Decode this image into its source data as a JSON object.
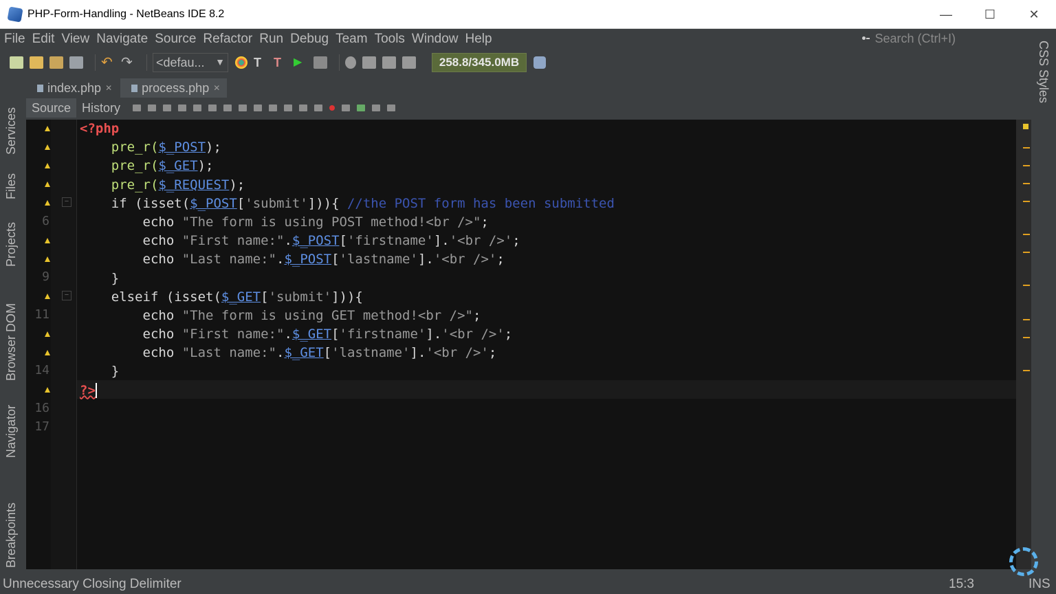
{
  "window": {
    "title": "PHP-Form-Handling - NetBeans IDE 8.2",
    "minimize": "—",
    "maximize": "☐",
    "close": "✕"
  },
  "menu": [
    "File",
    "Edit",
    "View",
    "Navigate",
    "Source",
    "Refactor",
    "Run",
    "Debug",
    "Team",
    "Tools",
    "Window",
    "Help"
  ],
  "search": {
    "placeholder": "Search (Ctrl+I)"
  },
  "toolbar": {
    "config": "<defau...",
    "memory": "258.8/345.0MB"
  },
  "left_tabs": [
    "Services",
    "Files",
    "Projects",
    "Browser DOM",
    "Navigator",
    "Breakpoints"
  ],
  "right_tabs": [
    "CSS Styles"
  ],
  "editor_tabs": [
    {
      "label": "index.php",
      "active": false
    },
    {
      "label": "process.php",
      "active": true
    }
  ],
  "editor_modes": {
    "source": "Source",
    "history": "History"
  },
  "line_numbers": {
    "l6": "6",
    "l9": "9",
    "l11": "11",
    "l14": "14",
    "l16": "16",
    "l17": "17"
  },
  "code": {
    "l1": "<?php",
    "l2_fn": "pre_r(",
    "l2_var": "$_POST",
    "l2_end": ");",
    "l3_fn": "pre_r(",
    "l3_var": "$_GET",
    "l3_end": ");",
    "l4_fn": "pre_r(",
    "l4_var": "$_REQUEST",
    "l4_end": ");",
    "l5_a": "if (isset(",
    "l5_var": "$_POST",
    "l5_b": "[",
    "l5_str": "'submit'",
    "l5_c": "])){ ",
    "l5_cmt": "//the POST form has been submitted",
    "l6_a": "echo ",
    "l6_str": "\"The form is using POST method!<br />\"",
    "l6_b": ";",
    "l7_a": "echo ",
    "l7_str": "\"First name:\"",
    "l7_b": ".",
    "l7_var": "$_POST",
    "l7_c": "[",
    "l7_str2": "'firstname'",
    "l7_d": "].",
    "l7_str3": "'<br />'",
    "l7_e": ";",
    "l8_a": "echo ",
    "l8_str": "\"Last name:\"",
    "l8_b": ".",
    "l8_var": "$_POST",
    "l8_c": "[",
    "l8_str2": "'lastname'",
    "l8_d": "].",
    "l8_str3": "'<br />'",
    "l8_e": ";",
    "l9": "}",
    "l10_a": "elseif (isset(",
    "l10_var": "$_GET",
    "l10_b": "[",
    "l10_str": "'submit'",
    "l10_c": "])){",
    "l11_a": "echo ",
    "l11_str": "\"The form is using GET method!<br />\"",
    "l11_b": ";",
    "l12_a": "echo ",
    "l12_str": "\"First name:\"",
    "l12_b": ".",
    "l12_var": "$_GET",
    "l12_c": "[",
    "l12_str2": "'firstname'",
    "l12_d": "].",
    "l12_str3": "'<br />'",
    "l12_e": ";",
    "l13_a": "echo ",
    "l13_str": "\"Last name:\"",
    "l13_b": ".",
    "l13_var": "$_GET",
    "l13_c": "[",
    "l13_str2": "'lastname'",
    "l13_d": "].",
    "l13_str3": "'<br />'",
    "l13_e": ";",
    "l14": "}",
    "l15": "?>"
  },
  "status": {
    "message": "Unnecessary Closing Delimiter",
    "position": "15:3",
    "mode": "INS"
  }
}
